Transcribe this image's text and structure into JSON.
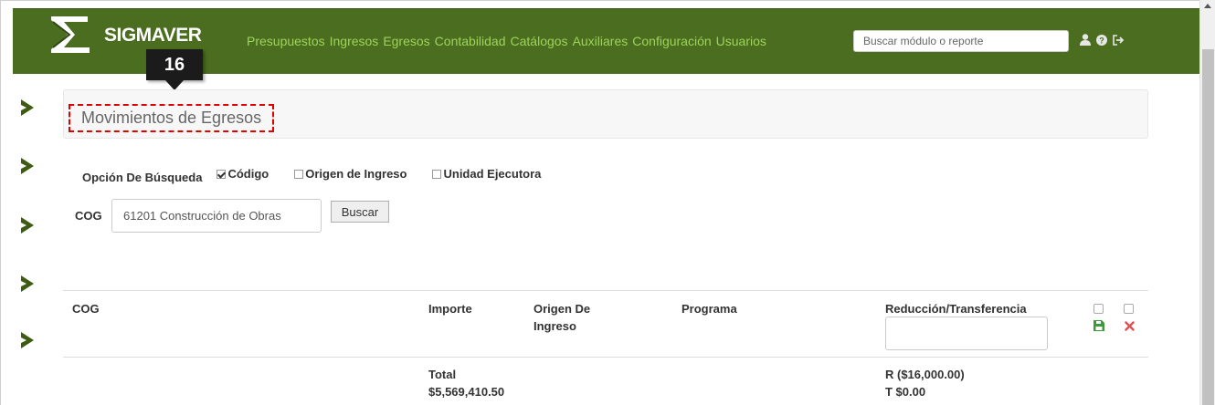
{
  "navbar": {
    "brand": "SIGMAVER",
    "links": [
      "Presupuestos",
      "Ingresos",
      "Egresos",
      "Contabilidad",
      "Catálogos",
      "Auxiliares",
      "Configuración",
      "Usuarios"
    ],
    "search_placeholder": "Buscar módulo o reporte",
    "icons": [
      "user-icon",
      "help-icon",
      "logout-icon"
    ],
    "color": "#4a6d1f",
    "link_color": "#9fd35a"
  },
  "step_badge": "16",
  "page_title": "Movimientos de Egresos",
  "search_options": {
    "label": "Opción De Búsqueda",
    "options": [
      {
        "label": "Código",
        "checked": true
      },
      {
        "label": "Origen de Ingreso",
        "checked": false
      },
      {
        "label": "Unidad Ejecutora",
        "checked": false
      }
    ]
  },
  "cog_field": {
    "label": "COG",
    "value": "61201 Construcción de Obras",
    "button": "Buscar"
  },
  "table": {
    "headers": {
      "cog": "COG",
      "importe": "Importe",
      "origen": "Origen De Ingreso",
      "programa": "Programa",
      "reduccion": "Reducción/Transferencia"
    },
    "totals": {
      "label": "Total",
      "importe": "$5,569,410.50",
      "reduccion": "R ($16,000.00)",
      "transferencia": "T $0.00"
    },
    "action_icons": [
      "save-icon",
      "delete-icon"
    ]
  },
  "accent_red": "#e00000"
}
